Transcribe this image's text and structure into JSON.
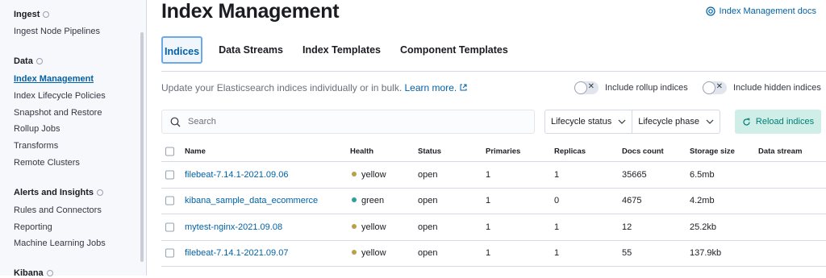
{
  "sidebar": {
    "sections": [
      {
        "title": "Ingest",
        "items": [
          "Ingest Node Pipelines"
        ]
      },
      {
        "title": "Data",
        "items": [
          "Index Management",
          "Index Lifecycle Policies",
          "Snapshot and Restore",
          "Rollup Jobs",
          "Transforms",
          "Remote Clusters"
        ]
      },
      {
        "title": "Alerts and Insights",
        "items": [
          "Rules and Connectors",
          "Reporting",
          "Machine Learning Jobs"
        ]
      },
      {
        "title": "Kibana",
        "items": []
      }
    ],
    "active_item": "Index Management"
  },
  "page": {
    "title": "Index Management",
    "docs_link": "Index Management docs"
  },
  "tabs": [
    {
      "label": "Indices",
      "active": true
    },
    {
      "label": "Data Streams",
      "active": false
    },
    {
      "label": "Index Templates",
      "active": false
    },
    {
      "label": "Component Templates",
      "active": false
    }
  ],
  "description": {
    "text": "Update your Elasticsearch indices individually or in bulk.",
    "link": "Learn more."
  },
  "toggles": {
    "rollup": "Include rollup indices",
    "hidden": "Include hidden indices"
  },
  "search": {
    "placeholder": "Search"
  },
  "filters": [
    "Lifecycle status",
    "Lifecycle phase"
  ],
  "reload_label": "Reload indices",
  "table": {
    "columns": [
      "Name",
      "Health",
      "Status",
      "Primaries",
      "Replicas",
      "Docs count",
      "Storage size",
      "Data stream"
    ],
    "rows": [
      {
        "name": "filebeat-7.14.1-2021.09.06",
        "health": "yellow",
        "status": "open",
        "primaries": "1",
        "replicas": "1",
        "docs": "35665",
        "size": "6.5mb",
        "stream": ""
      },
      {
        "name": "kibana_sample_data_ecommerce",
        "health": "green",
        "status": "open",
        "primaries": "1",
        "replicas": "0",
        "docs": "4675",
        "size": "4.2mb",
        "stream": ""
      },
      {
        "name": "mytest-nginx-2021.09.08",
        "health": "yellow",
        "status": "open",
        "primaries": "1",
        "replicas": "1",
        "docs": "12",
        "size": "25.2kb",
        "stream": ""
      },
      {
        "name": "filebeat-7.14.1-2021.09.07",
        "health": "yellow",
        "status": "open",
        "primaries": "1",
        "replicas": "1",
        "docs": "55",
        "size": "137.9kb",
        "stream": ""
      }
    ]
  },
  "colors": {
    "accent": "#0061a6",
    "yellow": "#b9a04b",
    "green": "#2aa197",
    "reload_bg": "#cfeee8",
    "reload_text": "#017d73"
  }
}
